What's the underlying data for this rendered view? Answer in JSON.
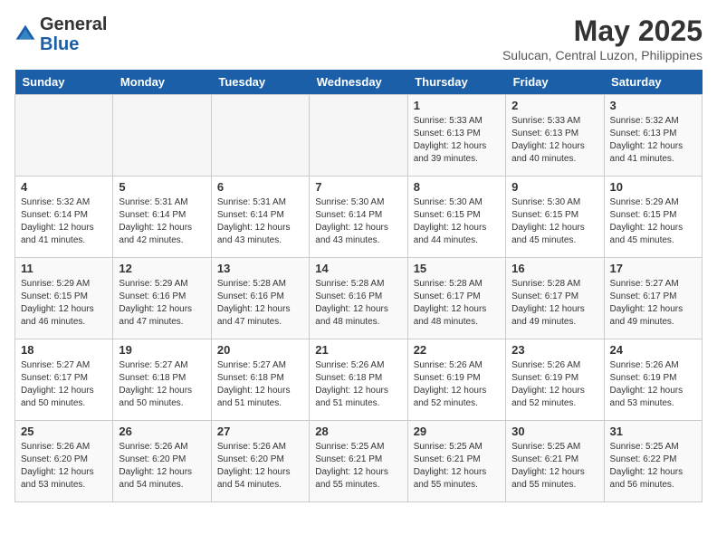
{
  "header": {
    "logo_general": "General",
    "logo_blue": "Blue",
    "month_title": "May 2025",
    "location": "Sulucan, Central Luzon, Philippines"
  },
  "days_of_week": [
    "Sunday",
    "Monday",
    "Tuesday",
    "Wednesday",
    "Thursday",
    "Friday",
    "Saturday"
  ],
  "weeks": [
    [
      {
        "day": "",
        "empty": true
      },
      {
        "day": "",
        "empty": true
      },
      {
        "day": "",
        "empty": true
      },
      {
        "day": "",
        "empty": true
      },
      {
        "day": "1",
        "sunrise": "5:33 AM",
        "sunset": "6:13 PM",
        "daylight": "12 hours and 39 minutes."
      },
      {
        "day": "2",
        "sunrise": "5:33 AM",
        "sunset": "6:13 PM",
        "daylight": "12 hours and 40 minutes."
      },
      {
        "day": "3",
        "sunrise": "5:32 AM",
        "sunset": "6:13 PM",
        "daylight": "12 hours and 41 minutes."
      }
    ],
    [
      {
        "day": "4",
        "sunrise": "5:32 AM",
        "sunset": "6:14 PM",
        "daylight": "12 hours and 41 minutes."
      },
      {
        "day": "5",
        "sunrise": "5:31 AM",
        "sunset": "6:14 PM",
        "daylight": "12 hours and 42 minutes."
      },
      {
        "day": "6",
        "sunrise": "5:31 AM",
        "sunset": "6:14 PM",
        "daylight": "12 hours and 43 minutes."
      },
      {
        "day": "7",
        "sunrise": "5:30 AM",
        "sunset": "6:14 PM",
        "daylight": "12 hours and 43 minutes."
      },
      {
        "day": "8",
        "sunrise": "5:30 AM",
        "sunset": "6:15 PM",
        "daylight": "12 hours and 44 minutes."
      },
      {
        "day": "9",
        "sunrise": "5:30 AM",
        "sunset": "6:15 PM",
        "daylight": "12 hours and 45 minutes."
      },
      {
        "day": "10",
        "sunrise": "5:29 AM",
        "sunset": "6:15 PM",
        "daylight": "12 hours and 45 minutes."
      }
    ],
    [
      {
        "day": "11",
        "sunrise": "5:29 AM",
        "sunset": "6:15 PM",
        "daylight": "12 hours and 46 minutes."
      },
      {
        "day": "12",
        "sunrise": "5:29 AM",
        "sunset": "6:16 PM",
        "daylight": "12 hours and 47 minutes."
      },
      {
        "day": "13",
        "sunrise": "5:28 AM",
        "sunset": "6:16 PM",
        "daylight": "12 hours and 47 minutes."
      },
      {
        "day": "14",
        "sunrise": "5:28 AM",
        "sunset": "6:16 PM",
        "daylight": "12 hours and 48 minutes."
      },
      {
        "day": "15",
        "sunrise": "5:28 AM",
        "sunset": "6:17 PM",
        "daylight": "12 hours and 48 minutes."
      },
      {
        "day": "16",
        "sunrise": "5:28 AM",
        "sunset": "6:17 PM",
        "daylight": "12 hours and 49 minutes."
      },
      {
        "day": "17",
        "sunrise": "5:27 AM",
        "sunset": "6:17 PM",
        "daylight": "12 hours and 49 minutes."
      }
    ],
    [
      {
        "day": "18",
        "sunrise": "5:27 AM",
        "sunset": "6:17 PM",
        "daylight": "12 hours and 50 minutes."
      },
      {
        "day": "19",
        "sunrise": "5:27 AM",
        "sunset": "6:18 PM",
        "daylight": "12 hours and 50 minutes."
      },
      {
        "day": "20",
        "sunrise": "5:27 AM",
        "sunset": "6:18 PM",
        "daylight": "12 hours and 51 minutes."
      },
      {
        "day": "21",
        "sunrise": "5:26 AM",
        "sunset": "6:18 PM",
        "daylight": "12 hours and 51 minutes."
      },
      {
        "day": "22",
        "sunrise": "5:26 AM",
        "sunset": "6:19 PM",
        "daylight": "12 hours and 52 minutes."
      },
      {
        "day": "23",
        "sunrise": "5:26 AM",
        "sunset": "6:19 PM",
        "daylight": "12 hours and 52 minutes."
      },
      {
        "day": "24",
        "sunrise": "5:26 AM",
        "sunset": "6:19 PM",
        "daylight": "12 hours and 53 minutes."
      }
    ],
    [
      {
        "day": "25",
        "sunrise": "5:26 AM",
        "sunset": "6:20 PM",
        "daylight": "12 hours and 53 minutes."
      },
      {
        "day": "26",
        "sunrise": "5:26 AM",
        "sunset": "6:20 PM",
        "daylight": "12 hours and 54 minutes."
      },
      {
        "day": "27",
        "sunrise": "5:26 AM",
        "sunset": "6:20 PM",
        "daylight": "12 hours and 54 minutes."
      },
      {
        "day": "28",
        "sunrise": "5:25 AM",
        "sunset": "6:21 PM",
        "daylight": "12 hours and 55 minutes."
      },
      {
        "day": "29",
        "sunrise": "5:25 AM",
        "sunset": "6:21 PM",
        "daylight": "12 hours and 55 minutes."
      },
      {
        "day": "30",
        "sunrise": "5:25 AM",
        "sunset": "6:21 PM",
        "daylight": "12 hours and 55 minutes."
      },
      {
        "day": "31",
        "sunrise": "5:25 AM",
        "sunset": "6:22 PM",
        "daylight": "12 hours and 56 minutes."
      }
    ]
  ]
}
